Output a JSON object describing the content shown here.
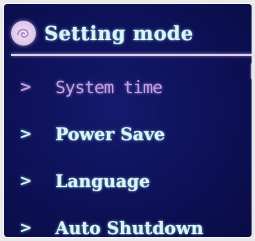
{
  "header": {
    "logo_icon": "swirl-logo-icon",
    "title": "Setting mode"
  },
  "menu": {
    "items": [
      {
        "label": "System time",
        "selected": true,
        "icon": "chevron-right-icon"
      },
      {
        "label": "Power Save",
        "selected": false,
        "icon": "chevron-right-icon"
      },
      {
        "label": "Language",
        "selected": false,
        "icon": "chevron-right-icon"
      },
      {
        "label": "Auto Shutdown",
        "selected": false,
        "icon": "chevron-right-icon"
      }
    ],
    "chevron_glyph": ">"
  },
  "colors": {
    "background": "#0d1157",
    "text": "#d7f4f6",
    "selected_text": "#c39ee0",
    "divider": "#d9c6ee"
  }
}
